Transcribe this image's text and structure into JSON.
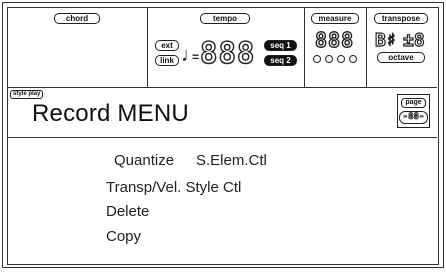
{
  "status": {
    "chord": {
      "label": "chord"
    },
    "tempo": {
      "label": "tempo",
      "ext_label": "ext",
      "link_label": "link",
      "eq": "=",
      "value": "888",
      "seq1_label": "seq 1",
      "seq2_label": "seq 2"
    },
    "measure": {
      "label": "measure",
      "value": "888"
    },
    "transpose": {
      "label": "transpose",
      "key": "B♯",
      "value": "±8",
      "octave_label": "octave"
    }
  },
  "header": {
    "mode_tag": "style play",
    "title": "Record MENU",
    "page_label": "page",
    "page_value": "-88-"
  },
  "menu": {
    "items": [
      {
        "label": "Quantize"
      },
      {
        "label": "S.Elem.Ctl"
      },
      {
        "label": "Transp/Vel. Style Ctl"
      },
      {
        "label": "Delete"
      },
      {
        "label": "Copy"
      }
    ]
  }
}
